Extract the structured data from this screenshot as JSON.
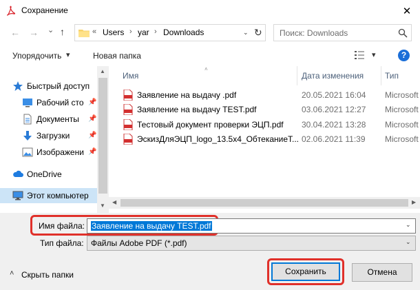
{
  "window": {
    "title": "Сохранение",
    "close_glyph": "✕"
  },
  "nav": {
    "back_glyph": "←",
    "forward_glyph": "→",
    "dropdown_glyph": "⌄",
    "up_glyph": "↑"
  },
  "address": {
    "overflow": "«",
    "crumbs": [
      "Users",
      "yar",
      "Downloads"
    ],
    "separator": "›",
    "dropdown_glyph": "⌄",
    "refresh_glyph": "↻"
  },
  "search": {
    "placeholder": "Поиск: Downloads"
  },
  "toolbar": {
    "organize_label": "Упорядочить",
    "organize_arrow": "▾",
    "new_folder_label": "Новая папка",
    "view_arrow": "▾",
    "help_glyph": "?"
  },
  "sidebar": {
    "items": [
      {
        "label": "Быстрый доступ",
        "icon": "star-icon"
      },
      {
        "label": "Рабочий сто",
        "icon": "desktop-icon",
        "pinned": true
      },
      {
        "label": "Документы",
        "icon": "documents-icon",
        "pinned": true
      },
      {
        "label": "Загрузки",
        "icon": "downloads-icon",
        "pinned": true
      },
      {
        "label": "Изображени",
        "icon": "pictures-icon",
        "pinned": true
      },
      {
        "label": "OneDrive",
        "icon": "cloud-icon"
      },
      {
        "label": "Этот компьютер",
        "icon": "computer-icon",
        "selected": true
      }
    ],
    "pin_glyph": "📌"
  },
  "filelist": {
    "columns": {
      "name": "Имя",
      "date": "Дата изменения",
      "type": "Тип"
    },
    "sort_glyph": "˄",
    "rows": [
      {
        "name": "Заявление на выдачу .pdf",
        "date": "20.05.2021 16:04",
        "type": "Microsoft"
      },
      {
        "name": "Заявление на выдачу TEST.pdf",
        "date": "03.06.2021 12:27",
        "type": "Microsoft"
      },
      {
        "name": "Тестовый документ проверки ЭЦП.pdf",
        "date": "30.04.2021 13:28",
        "type": "Microsoft"
      },
      {
        "name": "ЭскизДляЭЦП_logo_13.5x4_ОбтеканиеТ...",
        "date": "02.06.2021 11:39",
        "type": "Microsoft"
      }
    ]
  },
  "form": {
    "filename_label": "Имя файла:",
    "filename_value": "Заявление на выдачу TEST.pdf",
    "filetype_label": "Тип файла:",
    "filetype_value": "Файлы Adobe PDF (*.pdf)",
    "dropdown_glyph": "⌄"
  },
  "footer": {
    "hide_folders_label": "Скрыть папки",
    "hide_folders_glyph": "˄",
    "save_label": "Сохранить",
    "cancel_label": "Отмена"
  },
  "colors": {
    "accent": "#0078d7",
    "highlight": "#e0302a",
    "selected_nav": "#cce4f7"
  }
}
